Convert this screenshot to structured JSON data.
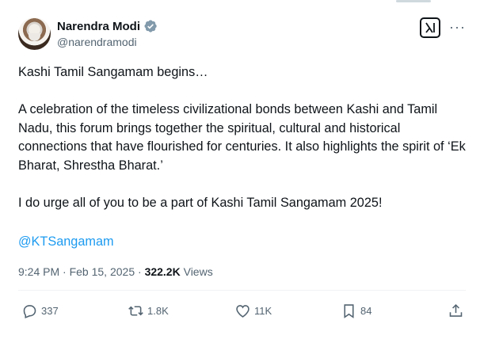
{
  "author": {
    "name": "Narendra Modi",
    "handle": "@narendramodi",
    "verified_icon": "verified-badge-icon"
  },
  "post": {
    "paragraphs": [
      "Kashi Tamil Sangamam begins…",
      "A celebration of the timeless civilizational bonds between Kashi and Tamil Nadu, this forum brings together the spiritual, cultural and historical connections that have flourished for centuries. It also highlights the spirit of ‘Ek Bharat, Shrestha Bharat.’",
      "I do urge all of you to be a part of Kashi Tamil Sangamam 2025!"
    ],
    "mention": "@KTSangamam"
  },
  "meta": {
    "time": "9:24 PM",
    "separator": " · ",
    "date": "Feb 15, 2025",
    "views_count": "322.2K",
    "views_label": " Views"
  },
  "actions": {
    "replies": "337",
    "reposts": "1.8K",
    "likes": "11K",
    "bookmarks": "84"
  },
  "icons": [
    "grok-icon",
    "more-icon",
    "reply-icon",
    "repost-icon",
    "like-icon",
    "bookmark-icon",
    "share-icon"
  ],
  "colors": {
    "link": "#1d9bf0",
    "verified": "#829aab",
    "secondary_text": "#536471"
  }
}
